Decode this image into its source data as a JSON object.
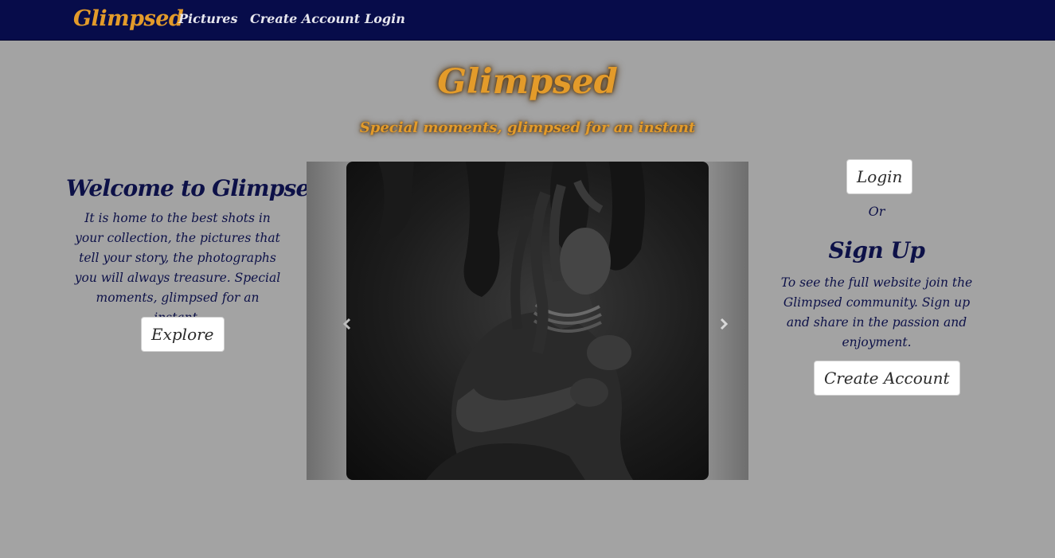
{
  "nav": {
    "brand": "Glimpsed",
    "links": [
      "Pictures",
      "Create Account",
      "Login"
    ]
  },
  "hero": {
    "title": "Glimpsed",
    "subtitle": "Special moments, glimpsed for an instant"
  },
  "welcome": {
    "title": "Welcome to Glimpsed",
    "text": "It is home to the best shots in your collection, the pictures that tell your story, the photographs you will always treasure. Special moments, glimpsed for an instant.",
    "button": "Explore"
  },
  "carousel": {
    "prev_icon": "chevron-left-icon",
    "next_icon": "chevron-right-icon"
  },
  "signup": {
    "login_button": "Login",
    "or_text": "Or",
    "title": "Sign Up",
    "text": "To see the full website join the Glimpsed community. Sign up and share in the passion and enjoyment.",
    "button": "Create Account"
  },
  "colors": {
    "navbar": "#070c4a",
    "accent": "#e39b2a",
    "background": "#a3a3a3",
    "text": "#0d1148"
  }
}
